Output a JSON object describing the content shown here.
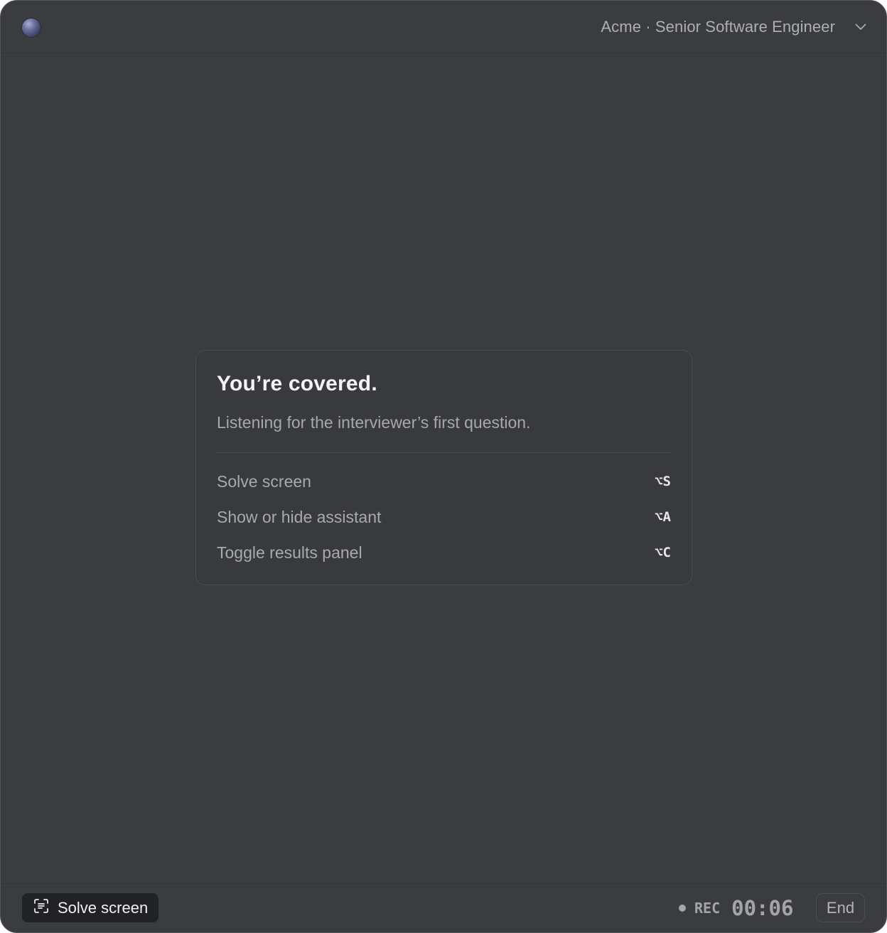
{
  "header": {
    "session_title": "Acme · Senior Software Engineer",
    "dropdown_icon": "chevron-down-icon"
  },
  "card": {
    "title": "You’re covered.",
    "subtitle": "Listening for the interviewer’s first question.",
    "shortcuts": [
      {
        "label": "Solve screen",
        "key": "⌥S"
      },
      {
        "label": "Show or hide assistant",
        "key": "⌥A"
      },
      {
        "label": "Toggle results panel",
        "key": "⌥C"
      }
    ]
  },
  "footer": {
    "solve_button_label": "Solve screen",
    "solve_button_icon": "scan-text-icon",
    "rec_label": "REC",
    "timer": "00:06",
    "end_label": "End"
  },
  "colors": {
    "window_bg": "#3b3c40",
    "card_bg": "#393a3e",
    "button_dark": "#202226"
  }
}
